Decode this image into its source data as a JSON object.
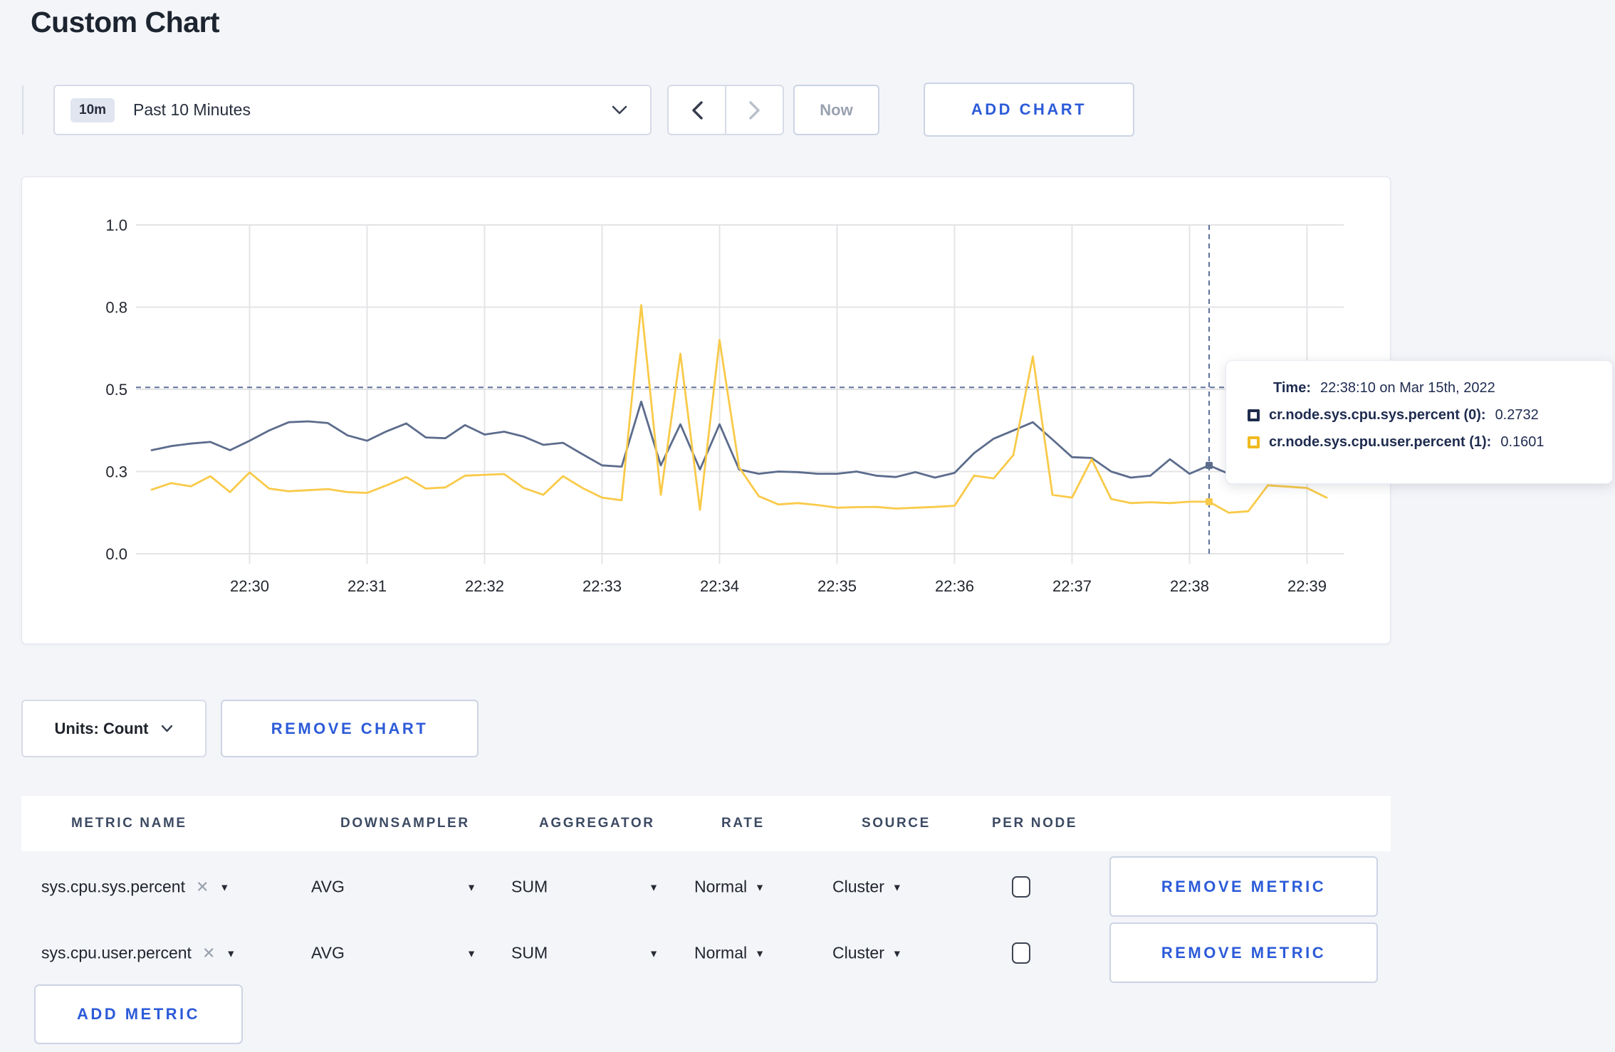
{
  "page": {
    "title": "Custom Chart"
  },
  "toolbar": {
    "time_range": {
      "badge": "10m",
      "label": "Past 10 Minutes"
    },
    "now_label": "Now",
    "add_chart_label": "ADD CHART"
  },
  "chart_data": {
    "type": "line",
    "title": "",
    "xlabel": "",
    "ylabel": "",
    "grid": true,
    "legend_position": "none",
    "y_tick_labels": [
      "1.0",
      "0.8",
      "0.5",
      "0.3",
      "0.0"
    ],
    "y_tick_values": [
      1.0,
      0.8,
      0.5,
      0.3,
      0.0
    ],
    "x_tick_labels": [
      "22:30",
      "22:31",
      "22:32",
      "22:33",
      "22:34",
      "22:35",
      "22:36",
      "22:37",
      "22:38",
      "22:39"
    ],
    "first_tick_index": 5,
    "tick_step": 6,
    "point_interval_seconds": 10,
    "series": [
      {
        "name": "cr.node.sys.cpu.sys.percent (0)",
        "color": "#5c6c8c",
        "values": [
          0.352,
          0.362,
          0.368,
          0.372,
          0.352,
          0.375,
          0.4,
          0.42,
          0.422,
          0.418,
          0.388,
          0.375,
          0.398,
          0.417,
          0.383,
          0.381,
          0.413,
          0.39,
          0.397,
          0.385,
          0.365,
          0.37,
          0.342,
          0.315,
          0.312,
          0.47,
          0.315,
          0.415,
          0.305,
          0.415,
          0.305,
          0.292,
          0.3,
          0.298,
          0.292,
          0.292,
          0.3,
          0.285,
          0.28,
          0.298,
          0.278,
          0.295,
          0.345,
          0.38,
          0.4,
          0.42,
          0.378,
          0.335,
          0.333,
          0.3,
          0.278,
          0.285,
          0.33,
          0.292,
          0.315,
          0.292,
          0.288,
          0.295,
          0.3,
          0.295,
          0.298
        ]
      },
      {
        "name": "cr.node.sys.cpu.user.percent (1)",
        "color": "#f9ca49",
        "values": [
          0.234,
          0.258,
          0.246,
          0.283,
          0.225,
          0.297,
          0.238,
          0.228,
          0.232,
          0.236,
          0.225,
          0.222,
          0.25,
          0.28,
          0.238,
          0.242,
          0.285,
          0.288,
          0.291,
          0.24,
          0.215,
          0.283,
          0.24,
          0.205,
          0.195,
          0.805,
          0.215,
          0.63,
          0.16,
          0.68,
          0.31,
          0.21,
          0.18,
          0.185,
          0.178,
          0.168,
          0.17,
          0.171,
          0.165,
          0.168,
          0.171,
          0.175,
          0.285,
          0.275,
          0.34,
          0.62,
          0.215,
          0.205,
          0.33,
          0.2,
          0.185,
          0.188,
          0.185,
          0.19,
          0.19,
          0.15,
          0.155,
          0.25,
          0.245,
          0.24,
          0.205
        ]
      }
    ],
    "crosshair": {
      "index": 54,
      "h_line_value": 0.507,
      "dash_color": "#5e729b"
    }
  },
  "tooltip": {
    "time_label": "Time:",
    "time_value": "22:38:10 on Mar 15th, 2022",
    "entries": [
      {
        "label": "cr.node.sys.cpu.sys.percent (0):",
        "value": "0.2732",
        "swatch_color": "#1e2b4d"
      },
      {
        "label": "cr.node.sys.cpu.user.percent (1):",
        "value": "0.1601",
        "swatch_color": "#f0ba20"
      }
    ]
  },
  "chart_controls": {
    "units_label": "Units: Count",
    "remove_chart_label": "REMOVE CHART",
    "add_metric_label": "ADD METRIC"
  },
  "metrics_table": {
    "headers": [
      "METRIC NAME",
      "DOWNSAMPLER",
      "AGGREGATOR",
      "RATE",
      "SOURCE",
      "PER NODE"
    ],
    "rows": [
      {
        "metric": "sys.cpu.sys.percent",
        "downsampler": "AVG",
        "aggregator": "SUM",
        "rate": "Normal",
        "source": "Cluster",
        "per_node_checked": false,
        "remove_label": "REMOVE METRIC"
      },
      {
        "metric": "sys.cpu.user.percent",
        "downsampler": "AVG",
        "aggregator": "SUM",
        "rate": "Normal",
        "source": "Cluster",
        "per_node_checked": false,
        "remove_label": "REMOVE METRIC"
      }
    ]
  },
  "colors": {
    "accent_blue": "#2c5bd9",
    "series_sys": "#5c6c8c",
    "series_user": "#f9ca49",
    "page_bg": "#f4f5f9"
  }
}
